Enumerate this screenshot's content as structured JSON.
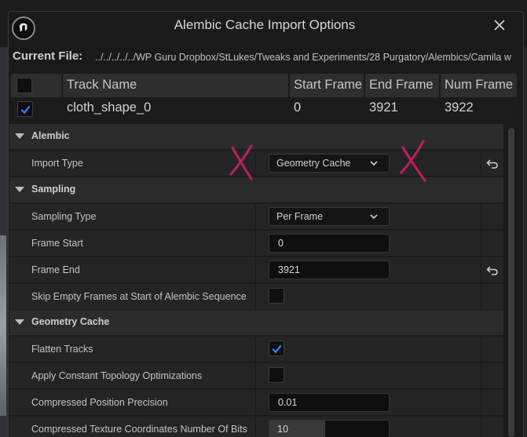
{
  "window": {
    "title": "Alembic Cache Import Options",
    "logo_icon": "unreal-engine-logo-icon",
    "close_icon": "close-icon"
  },
  "current_file": {
    "label": "Current File:",
    "path": "../../../../../WP Guru Dropbox/StLukes/Tweaks and Experiments/28 Purgatory/Alembics/Camila w"
  },
  "track_table": {
    "columns": [
      "Track Name",
      "Start Frame",
      "End Frame",
      "Num Frame"
    ],
    "rows": [
      {
        "checked": true,
        "track_name": "cloth_shape_0",
        "start_frame": "0",
        "end_frame": "3921",
        "num_frames": "3922"
      }
    ]
  },
  "details": {
    "alembic": {
      "label": "Alembic",
      "import_type": {
        "label": "Import Type",
        "value": "Geometry Cache"
      }
    },
    "sampling": {
      "label": "Sampling",
      "sampling_type": {
        "label": "Sampling Type",
        "value": "Per Frame"
      },
      "frame_start": {
        "label": "Frame Start",
        "value": "0"
      },
      "frame_end": {
        "label": "Frame End",
        "value": "3921"
      },
      "skip_empty": {
        "label": "Skip Empty Frames at Start of Alembic Sequence",
        "checked": false
      }
    },
    "geometry_cache": {
      "label": "Geometry Cache",
      "flatten_tracks": {
        "label": "Flatten Tracks",
        "checked": true
      },
      "constant_topology": {
        "label": "Apply Constant Topology Optimizations",
        "checked": false
      },
      "position_precision": {
        "label": "Compressed Position Precision",
        "value": "0.01"
      },
      "texcoord_bits": {
        "label": "Compressed Texture Coordinates Number Of Bits",
        "value": "10",
        "slider_fraction": 0.47
      }
    }
  },
  "annotations": {
    "marks": [
      "X",
      "X"
    ],
    "color": "#b5205e"
  },
  "colors": {
    "checkbox_check": "#3d7bff",
    "background": "#242424",
    "category": "#2b2b2b"
  }
}
